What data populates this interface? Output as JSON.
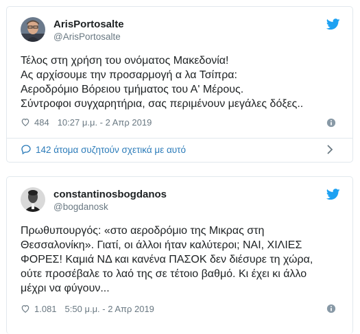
{
  "tweets": [
    {
      "name": "ArisPortosalte",
      "handle": "@ArisPortosalte",
      "lines": [
        "Τέλος στη χρήση του ονόματος Μακεδονία!",
        "Ας αρχίσουμε την προσαρμογή α λα Τσίπρα:",
        "Αεροδρόμιο Βόρειου τμήματος του Α' Μέρους.",
        "Σύντροφοι συγχαρητήρια, σας περιμένουν μεγάλες δόξες.."
      ],
      "likes": "484",
      "timestamp": "10:27 μ.μ. - 2 Απρ 2019",
      "conversation": "142 άτομα συζητούν σχετικά με αυτό"
    },
    {
      "name": "constantinosbogdanos",
      "handle": "@bogdanosk",
      "lines": [
        "Πρωθυπουργός: «στο αεροδρόμιο της Μικρας στη",
        "Θεσσαλονίκη». Γιατί, οι άλλοι ήταν καλύτεροι; ΝΑΙ, ΧΙΛΙΕΣ",
        "ΦΟΡΕΣ! Καμιά ΝΔ και κανένα ΠΑΣΟΚ δεν διέσυρε τη χώρα,",
        "ούτε προσέβαλε το λαό της σε τέτοιο βαθμό. Κι έχει κι άλλο",
        "μέχρι να φύγουν..."
      ],
      "likes": "1.081",
      "timestamp": "5:50 μ.μ. - 2 Απρ 2019"
    }
  ],
  "icons": {
    "brand": "twitter-bird-icon",
    "like": "heart-icon",
    "info": "info-icon",
    "conversation": "comment-bubble-icon",
    "chevron": "chevron-right-icon"
  },
  "colors": {
    "twitter_blue": "#1da1f2",
    "link_blue": "#2b7bb9",
    "muted": "#697882",
    "border": "#e1e8ed"
  }
}
